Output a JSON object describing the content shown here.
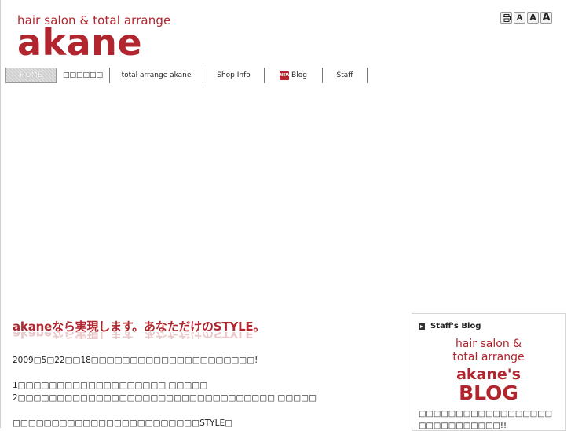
{
  "header": {
    "tagline": "hair salon & total arrange",
    "brand": "akane",
    "tools": {
      "small": "A",
      "medium": "A",
      "large": "A"
    }
  },
  "nav": {
    "items": [
      {
        "label": "HOME"
      },
      {
        "label": "□□□□□□"
      },
      {
        "label": "total arrange akane"
      },
      {
        "label": "Shop Info"
      },
      {
        "label": "Blog",
        "badge": "NEW"
      },
      {
        "label": "Staff"
      }
    ]
  },
  "main": {
    "headline": "akaneなら実現します。あなただけのSTYLE。",
    "lines": [
      "2009□5□22□□18□□□□□□□□□□□□□□□□□□□□□!",
      "1□□□□□□□□□□□□□□□□□□□ □□□□□",
      "2□□□□□□□□□□□□□□□□□□□□□□□□□□□□□□□□□ □□□□□",
      "□□□□□□□□□□□□□□□□□□□□□□□□STYLE□"
    ]
  },
  "sidebar": {
    "title": "Staff's Blog",
    "logo": {
      "line1": "hair salon &",
      "line2": "total arrange",
      "line3": "akane's",
      "line4": "BLOG"
    },
    "text1": "□□□□□□□□□□□□□□□□□□",
    "text2": "□□□□□□□□□□□!!"
  },
  "colors": {
    "brand": "#b0252e"
  }
}
